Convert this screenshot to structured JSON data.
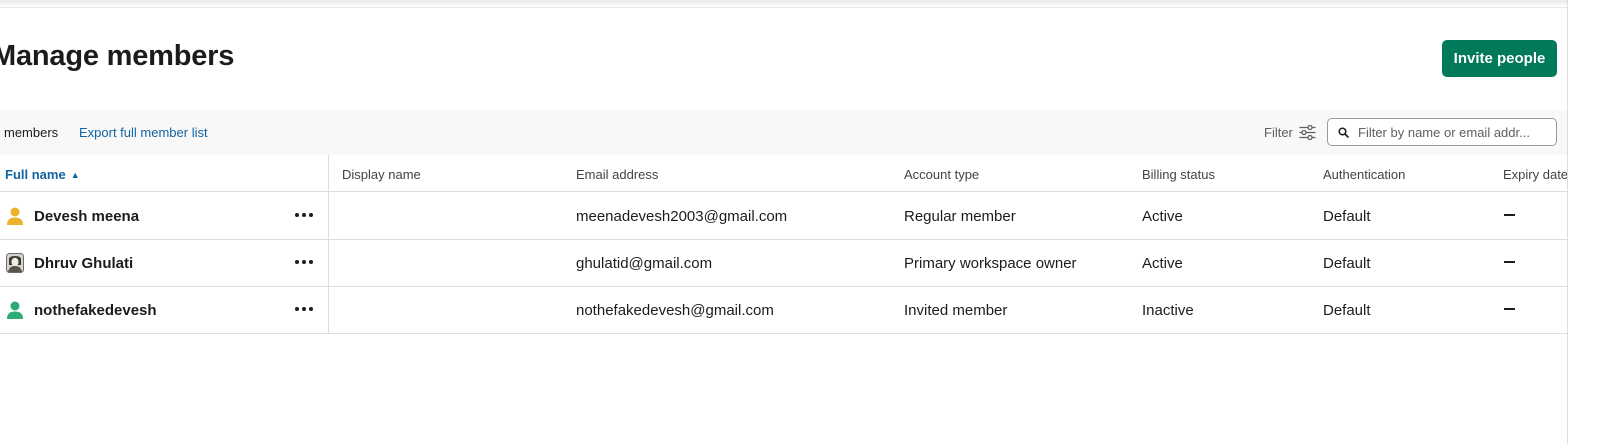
{
  "header": {
    "title": "Manage members",
    "invite_button": "Invite people"
  },
  "toolbar": {
    "member_count": "members",
    "export_link": "Export full member list",
    "filter_label": "Filter",
    "search_placeholder": "Filter by name or email addr..."
  },
  "table": {
    "columns": [
      "Full name",
      "Display name",
      "Email address",
      "Account type",
      "Billing status",
      "Authentication",
      "Expiry date"
    ],
    "sort": {
      "column": "Full name",
      "direction": "ascending"
    },
    "rows": [
      {
        "full_name": "Devesh meena",
        "display_name": "",
        "email": "meenadevesh2003@gmail.com",
        "account_type": "Regular member",
        "billing_status": "Active",
        "authentication": "Default",
        "expiry_date": "—",
        "avatar": "default-avatar-yellow"
      },
      {
        "full_name": "Dhruv Ghulati",
        "display_name": "",
        "email": "ghulatid@gmail.com",
        "account_type": "Primary workspace owner",
        "billing_status": "Active",
        "authentication": "Default",
        "expiry_date": "—",
        "avatar": "photo-avatar"
      },
      {
        "full_name": "nothefakedevesh",
        "display_name": "",
        "email": "nothefakedevesh@gmail.com",
        "account_type": "Invited member",
        "billing_status": "Inactive",
        "authentication": "Default",
        "expiry_date": "—",
        "avatar": "default-avatar-green"
      }
    ]
  },
  "colors": {
    "primary_button": "#007a5a",
    "link": "#1264a3",
    "toolbar_bg": "#f8f8f8",
    "avatar_yellow": "#ecb22e",
    "avatar_green": "#2bac76"
  }
}
